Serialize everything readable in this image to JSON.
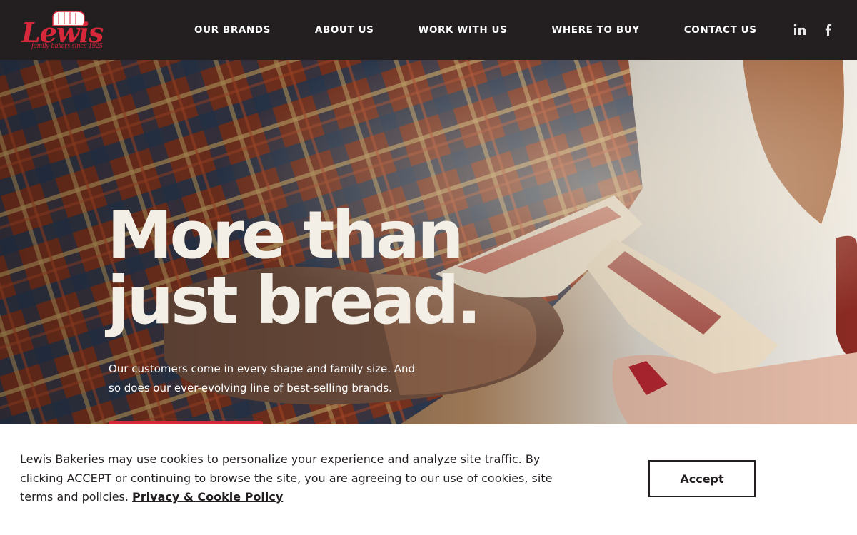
{
  "brand": {
    "name": "Lewis",
    "tagline": "family bakers since 1925",
    "color": "#d6283a"
  },
  "nav": {
    "items": [
      "OUR BRANDS",
      "ABOUT US",
      "WORK WITH US",
      "WHERE TO BUY",
      "CONTACT US"
    ]
  },
  "social": {
    "icons": [
      "linkedin-icon",
      "facebook-icon"
    ]
  },
  "hero": {
    "title_line1": "More than",
    "title_line2": "just bread.",
    "subtitle": "Our customers come in every shape and family size. And so does our ever-evolving line of best-selling brands."
  },
  "cookie": {
    "message": "Lewis Bakeries may use cookies to personalize your experience and analyze site traffic. By clicking ACCEPT or continuing to browse the site, you are agreeing to our use of cookies, site terms and policies.",
    "policy_link": "Privacy & Cookie Policy",
    "accept_label": "Accept"
  },
  "colors": {
    "header_bg": "#231f20",
    "accent": "#d6283a",
    "hero_text": "#f3efe6"
  }
}
